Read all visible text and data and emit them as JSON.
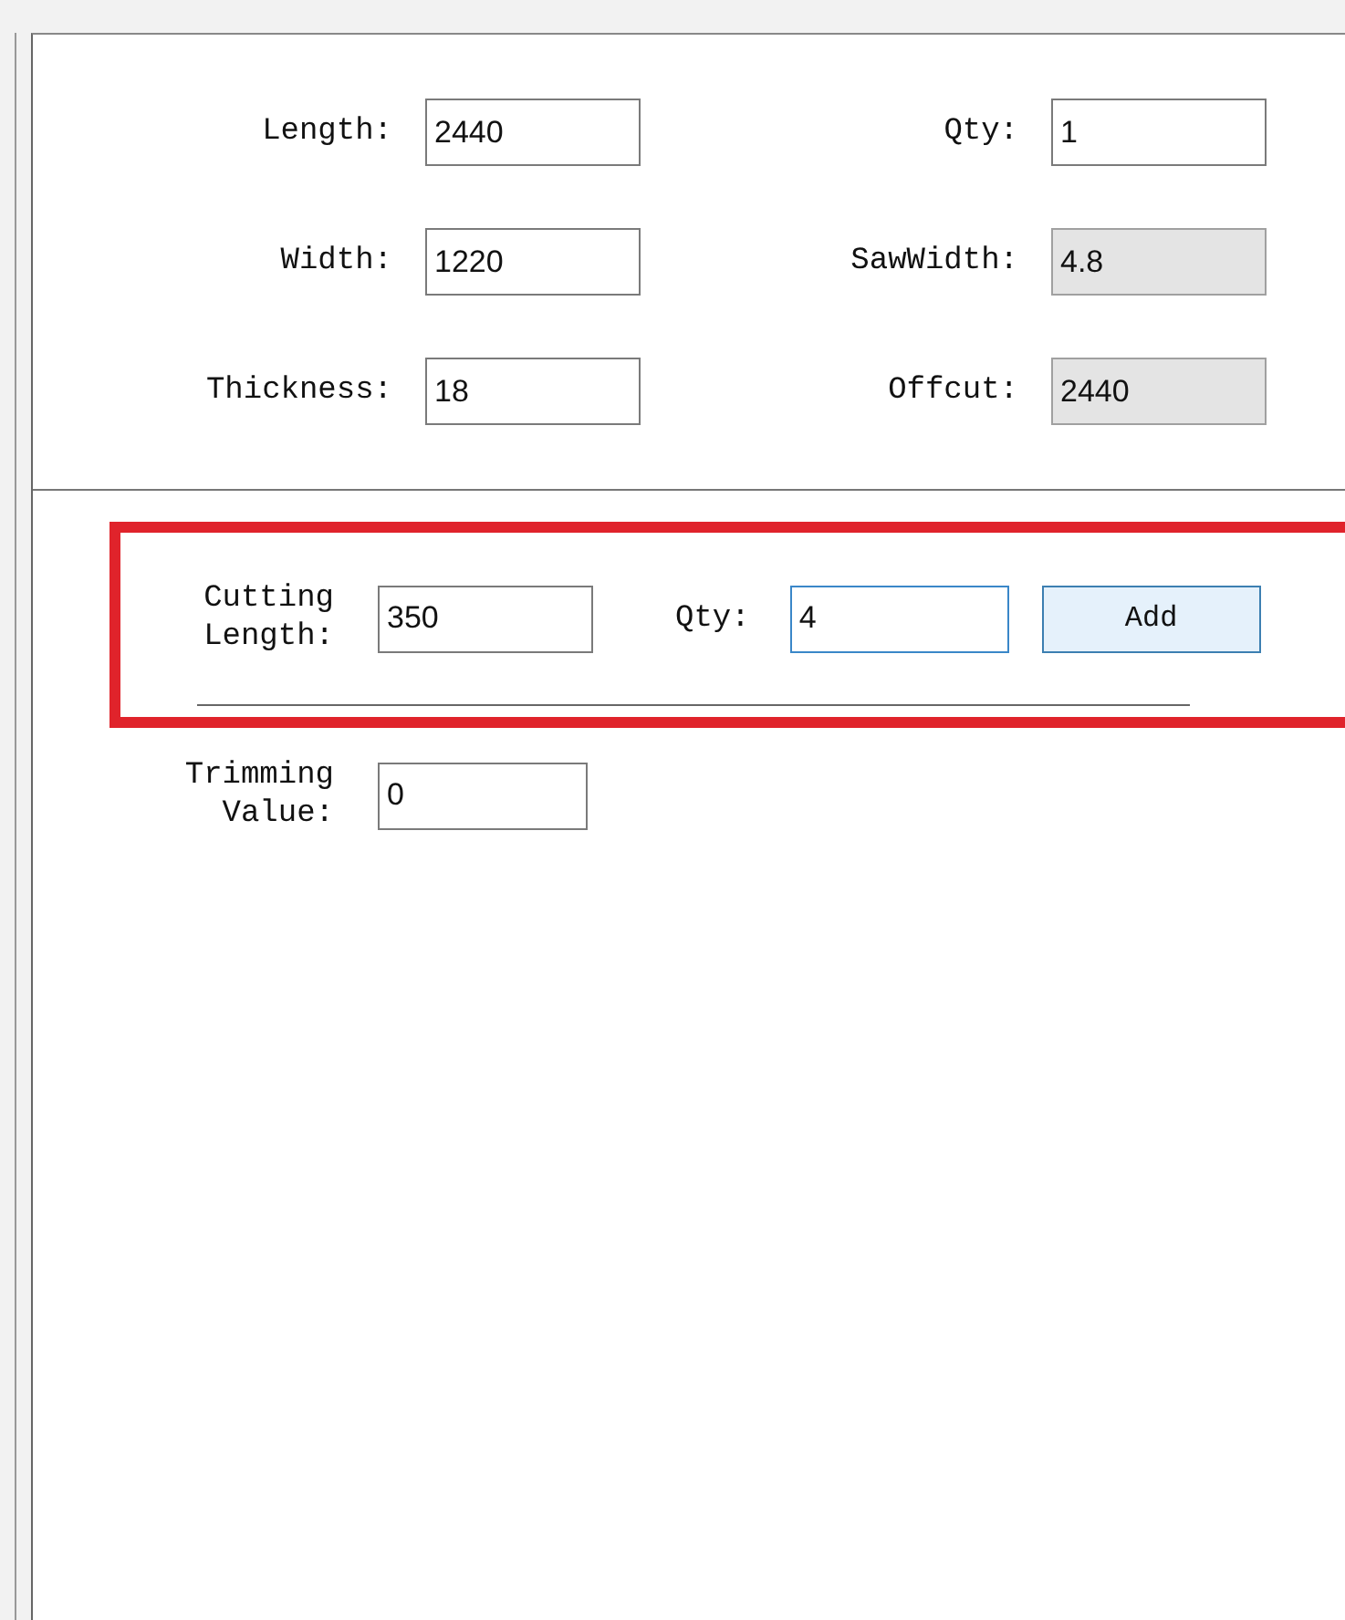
{
  "board_fields": [
    {
      "label": "Length:",
      "value": "2440",
      "readonly": false
    },
    {
      "label": "Qty:",
      "value": "1",
      "readonly": false
    },
    {
      "label": "Width:",
      "value": "1220",
      "readonly": false
    },
    {
      "label": "SawWidth:",
      "value": "4.8",
      "readonly": true
    },
    {
      "label": "Thickness:",
      "value": "18",
      "readonly": false
    },
    {
      "label": "Offcut:",
      "value": "2440",
      "readonly": true
    }
  ],
  "cutting": {
    "highlighted": true,
    "length_label": "Cutting\nLength:",
    "length_value": "350",
    "qty_label": "Qty:",
    "qty_value": "4",
    "qty_focused": true,
    "add_button": "Add"
  },
  "trimming": {
    "label": "Trimming\nValue:",
    "value": "0"
  }
}
